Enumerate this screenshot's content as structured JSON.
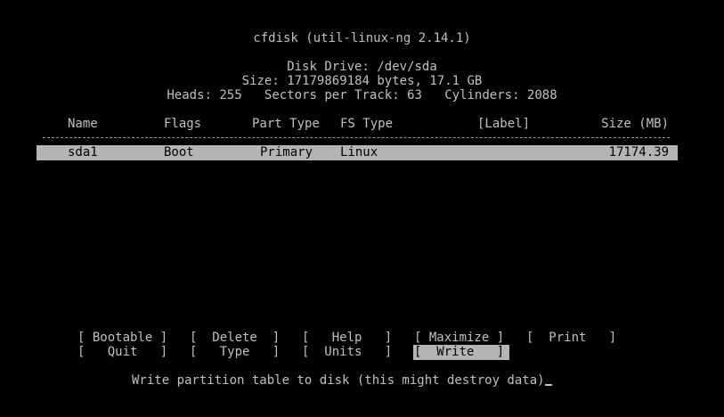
{
  "header": {
    "title": "cfdisk (util-linux-ng 2.14.1)",
    "disk_drive": "Disk Drive: /dev/sda",
    "size_line": "Size: 17179869184 bytes, 17.1 GB",
    "geometry_line": "Heads: 255   Sectors per Track: 63   Cylinders: 2088"
  },
  "table": {
    "columns": {
      "name": "Name",
      "flags": "Flags",
      "part_type": "Part Type",
      "fs_type": "FS Type",
      "label": "[Label]",
      "size": "Size (MB)"
    },
    "rows": [
      {
        "name": "sda1",
        "flags": "Boot",
        "part_type": "Primary",
        "fs_type": "Linux",
        "label": "",
        "size": "17174.39"
      }
    ]
  },
  "menu": {
    "bootable": "[ Bootable ]",
    "delete": "[  Delete  ]",
    "help": "[   Help   ]",
    "maximize": "[ Maximize ]",
    "print": "[  Print   ]",
    "quit": "[   Quit   ]",
    "type": "[   Type   ]",
    "units": "[  Units   ]",
    "write": "[  Write   ]"
  },
  "status": {
    "message": "Write partition table to disk (this might destroy data)"
  },
  "colors": {
    "background": "#000000",
    "text": "#c0c0c0",
    "highlight": "#b4b4b4",
    "highlight_text": "#000000"
  }
}
